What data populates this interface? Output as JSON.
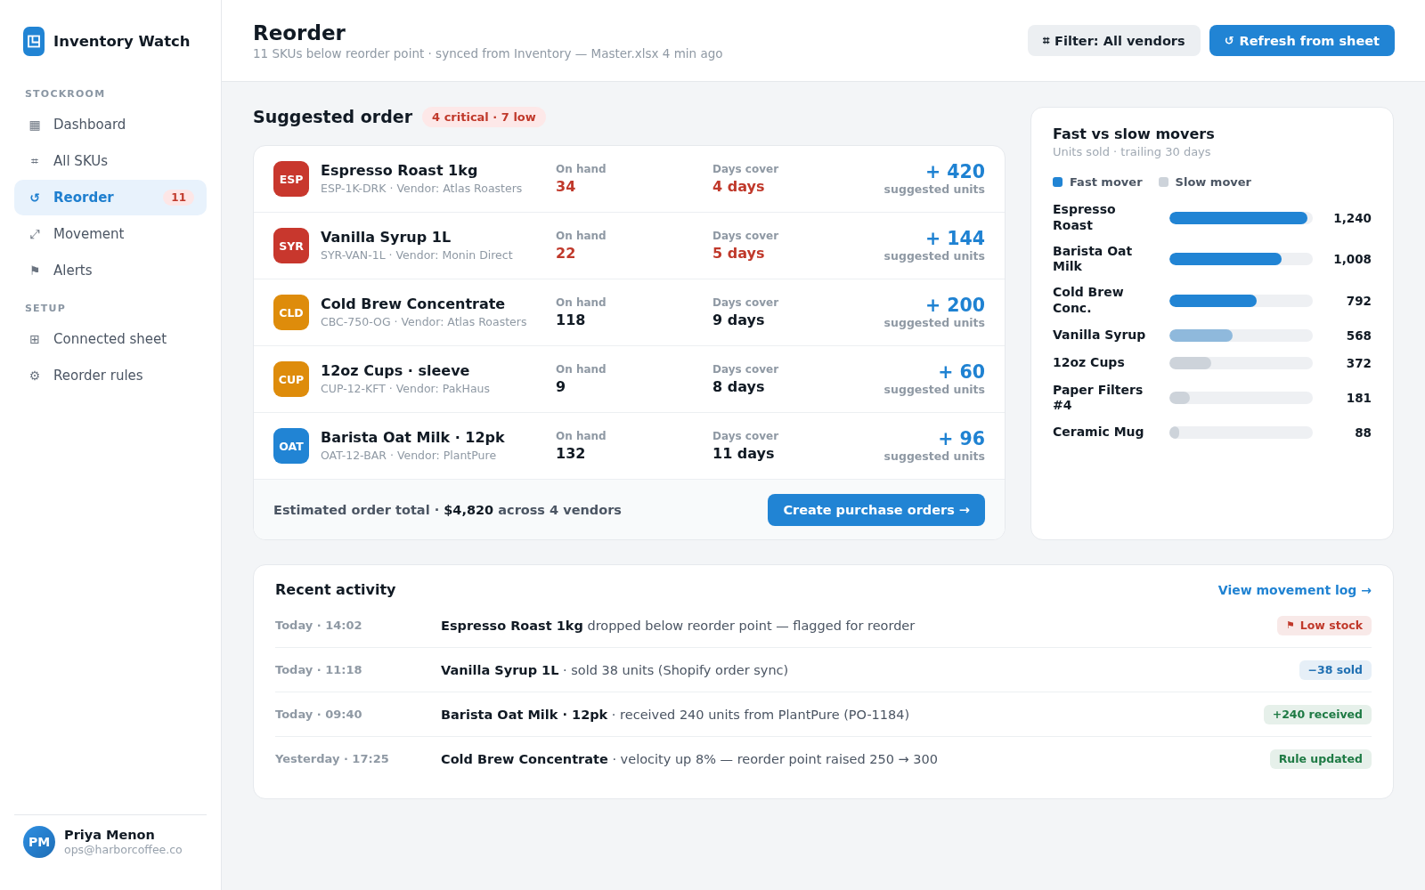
{
  "sidebar": {
    "brand": {
      "title": "Inventory Watch"
    },
    "sections": [
      {
        "heading": "STOCKROOM",
        "items": [
          {
            "icon": "▦",
            "label": "Dashboard",
            "selected": false
          },
          {
            "icon": "⌗",
            "label": "All SKUs",
            "selected": false
          },
          {
            "icon": "↺",
            "label": "Reorder",
            "selected": true,
            "badge": "11"
          },
          {
            "icon": "⤢",
            "label": "Movement",
            "selected": false
          },
          {
            "icon": "⚑",
            "label": "Alerts",
            "selected": false
          }
        ]
      },
      {
        "heading": "SETUP",
        "items": [
          {
            "icon": "⊞",
            "label": "Connected sheet",
            "selected": false
          },
          {
            "icon": "⚙",
            "label": "Reorder rules",
            "selected": false
          }
        ]
      }
    ],
    "user": {
      "initials": "PM",
      "name": "Priya Menon",
      "email": "ops@harborcoffee.co"
    }
  },
  "header": {
    "title": "Reorder",
    "subtitle": "11 SKUs below reorder point · synced from Inventory — Master.xlsx 4 min ago",
    "buttons": [
      {
        "icon": "⌗",
        "label": "Filter: All vendors",
        "kind": "secondary"
      },
      {
        "icon": "↺",
        "label": "Refresh from sheet",
        "kind": "primary"
      }
    ]
  },
  "suggested_order": {
    "title": "Suggested order",
    "summary": "4 critical · 7 low",
    "items": [
      {
        "code": "ESP",
        "color": "#c8372d",
        "name": "Espresso Roast 1kg",
        "meta": "ESP-1K-DRK · Vendor: Atlas Roasters",
        "on_hand_label": "On hand",
        "on_hand": "34",
        "days_cover_label": "Days cover",
        "days_cover": "4 days",
        "critical": true,
        "suggested": "+ 420",
        "suggested_label": "suggested units"
      },
      {
        "code": "SYR",
        "color": "#c8372d",
        "name": "Vanilla Syrup 1L",
        "meta": "SYR-VAN-1L · Vendor: Monin Direct",
        "on_hand_label": "On hand",
        "on_hand": "22",
        "days_cover_label": "Days cover",
        "days_cover": "5 days",
        "critical": true,
        "suggested": "+ 144",
        "suggested_label": "suggested units"
      },
      {
        "code": "CLD",
        "color": "#de8c0b",
        "name": "Cold Brew Concentrate",
        "meta": "CBC-750-OG · Vendor: Atlas Roasters",
        "on_hand_label": "On hand",
        "on_hand": "118",
        "days_cover_label": "Days cover",
        "days_cover": "9 days",
        "critical": false,
        "suggested": "+ 200",
        "suggested_label": "suggested units"
      },
      {
        "code": "CUP",
        "color": "#de8c0b",
        "name": "12oz Cups · sleeve",
        "meta": "CUP-12-KFT · Vendor: PakHaus",
        "on_hand_label": "On hand",
        "on_hand": "9",
        "days_cover_label": "Days cover",
        "days_cover": "8 days",
        "critical": false,
        "suggested": "+ 60",
        "suggested_label": "suggested units"
      },
      {
        "code": "OAT",
        "color": "#2184d4",
        "name": "Barista Oat Milk · 12pk",
        "meta": "OAT-12-BAR · Vendor: PlantPure",
        "on_hand_label": "On hand",
        "on_hand": "132",
        "days_cover_label": "Days cover",
        "days_cover": "11 days",
        "critical": false,
        "suggested": "+ 96",
        "suggested_label": "suggested units"
      }
    ],
    "footer": {
      "total": "Estimated order total · **$4,820** across 4 vendors",
      "button": "Create purchase orders →"
    }
  },
  "movers": {
    "title": "Fast vs slow movers",
    "subtitle": "Units sold · trailing 30 days",
    "legend": [
      {
        "label": "Fast mover",
        "color": "#2184d4"
      },
      {
        "label": "Slow mover",
        "color": "#cdd3da"
      }
    ],
    "items": [
      {
        "label": "Espresso Roast",
        "value": "1,240",
        "level": 0.965,
        "color": "#2184d4"
      },
      {
        "label": "Barista Oat Milk",
        "value": "1,008",
        "level": 0.78,
        "color": "#2184d4"
      },
      {
        "label": "Cold Brew Conc.",
        "value": "792",
        "level": 0.61,
        "color": "#2184d4"
      },
      {
        "label": "Vanilla Syrup",
        "value": "568",
        "level": 0.44,
        "color": "#8fb9dc"
      },
      {
        "label": "12oz Cups",
        "value": "372",
        "level": 0.29,
        "color": "#cdd3da"
      },
      {
        "label": "Paper Filters #4",
        "value": "181",
        "level": 0.143,
        "color": "#cdd3da"
      },
      {
        "label": "Ceramic Mug",
        "value": "88",
        "level": 0.068,
        "color": "#cdd3da"
      }
    ]
  },
  "activity": {
    "title": "Recent activity",
    "link": "View movement log →",
    "rows": [
      {
        "time": "Today · 14:02",
        "text": "**Espresso Roast 1kg** dropped below reorder point — flagged for reorder",
        "tag": {
          "icon": "⚑",
          "label": "Low stock",
          "color": "#c0392b"
        }
      },
      {
        "time": "Today · 11:18",
        "text": "**Vanilla Syrup 1L** · sold 38 units (Shopify order sync)",
        "tag": {
          "label": "−38 sold",
          "color": "#1f6fb2"
        }
      },
      {
        "time": "Today · 09:40",
        "text": "**Barista Oat Milk · 12pk** · received 240 units from PlantPure (PO-1184)",
        "tag": {
          "label": "+240 received",
          "color": "#1e7a44"
        }
      },
      {
        "time": "Yesterday · 17:25",
        "text": "**Cold Brew Concentrate** · velocity up 8% — reorder point raised 250 → 300",
        "tag": {
          "label": "Rule updated",
          "color": "#1e7a44"
        }
      }
    ]
  }
}
